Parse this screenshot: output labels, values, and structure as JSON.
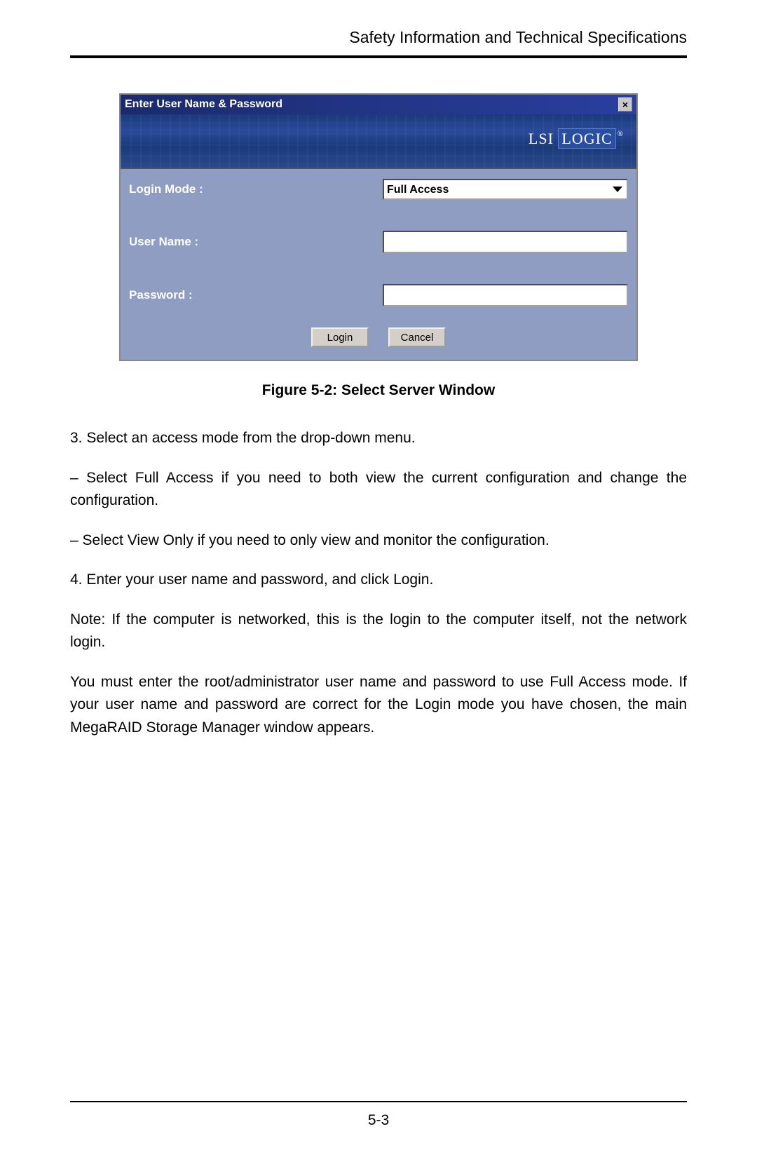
{
  "header": {
    "title": "Safety Information and Technical Specifications"
  },
  "dialog": {
    "title": "Enter User Name & Password",
    "close_symbol": "×",
    "logo_text_1": "LSI",
    "logo_text_2": "LOGIC",
    "logo_reg": "®",
    "login_mode_label": "Login Mode :",
    "login_mode_value": "Full Access",
    "user_name_label": "User Name :",
    "user_name_value": "",
    "password_label": "Password :",
    "password_value": "",
    "login_button": "Login",
    "cancel_button": "Cancel"
  },
  "figure_caption": "Figure 5-2: Select Server Window",
  "body": {
    "p1": "3. Select an access mode from the drop-down menu.",
    "p2": "– Select Full Access if you need to both view the current configuration and change the configuration.",
    "p3": "– Select View Only if you need to only view and monitor the configuration.",
    "p4": "4. Enter your user name and password, and click Login.",
    "p5": "Note: If the computer is networked, this is the login to the computer itself, not the network login.",
    "p6": "You must enter the root/administrator user name and password to use Full Access mode. If your user name and password are correct for the Login mode you have chosen, the main MegaRAID Storage Manager window appears."
  },
  "footer": {
    "page": "5-3"
  }
}
